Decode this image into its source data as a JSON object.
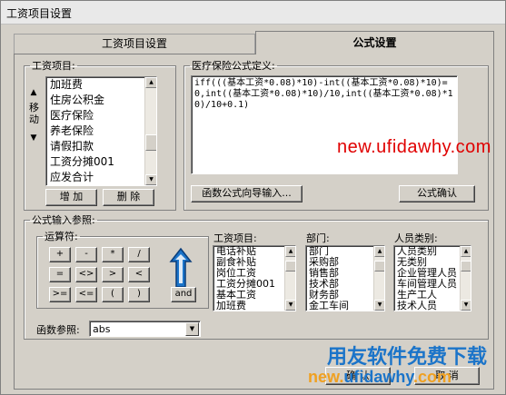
{
  "window": {
    "title": "工资项目设置"
  },
  "tabs": [
    {
      "label": "工资项目设置"
    },
    {
      "label": "公式设置"
    }
  ],
  "salary_items": {
    "legend": "工资项目:",
    "items": [
      "加班费",
      "住房公积金",
      "医疗保险",
      "养老保险",
      "请假扣款",
      "工资分摊001",
      "应发合计"
    ],
    "move_label": "移动",
    "add_label": "增 加",
    "delete_label": "删 除"
  },
  "formula": {
    "legend": "医疗保险公式定义:",
    "text": "iff(((基本工资*0.08)*10)-int((基本工资*0.08)*10)=0,int((基本工资*0.08)*10)/10,int((基本工资*0.08)*10)/10+0.1)",
    "wizard_label": "函数公式向导输入...",
    "confirm_label": "公式确认"
  },
  "input_ref": {
    "legend": "公式输入参照:",
    "operators_legend": "运算符:",
    "operators": [
      "+",
      "-",
      "*",
      "/",
      "=",
      "<>",
      ">",
      "<",
      ">=",
      "<=",
      "(",
      ")",
      "and"
    ],
    "salary_items_label": "工资项目:",
    "salary_items": [
      "电话补贴",
      "副食补贴",
      "岗位工资",
      "工资分摊001",
      "基本工资",
      "加班费"
    ],
    "department_label": "部门:",
    "departments": [
      "部门",
      "采购部",
      "销售部",
      "技术部",
      "财务部",
      "金工车间"
    ],
    "staff_type_label": "人员类别:",
    "staff_types": [
      "人员类别",
      "无类别",
      "企业管理人员",
      "车间管理人员",
      "生产工人",
      "技术人员"
    ],
    "function_ref_label": "函数参照:",
    "function_ref_value": "abs"
  },
  "footer": {
    "ok_label": "确 认",
    "cancel_label": "取 消"
  },
  "watermarks": {
    "url_top": "new.ufidawhy.com",
    "big_text": "用友软件免费下载",
    "url_bottom": "new.ufidawhy.com"
  },
  "colors": {
    "accent_blue": "#1b74c9",
    "watermark_red": "#e00000",
    "panel_bg": "#d4d0c8"
  }
}
